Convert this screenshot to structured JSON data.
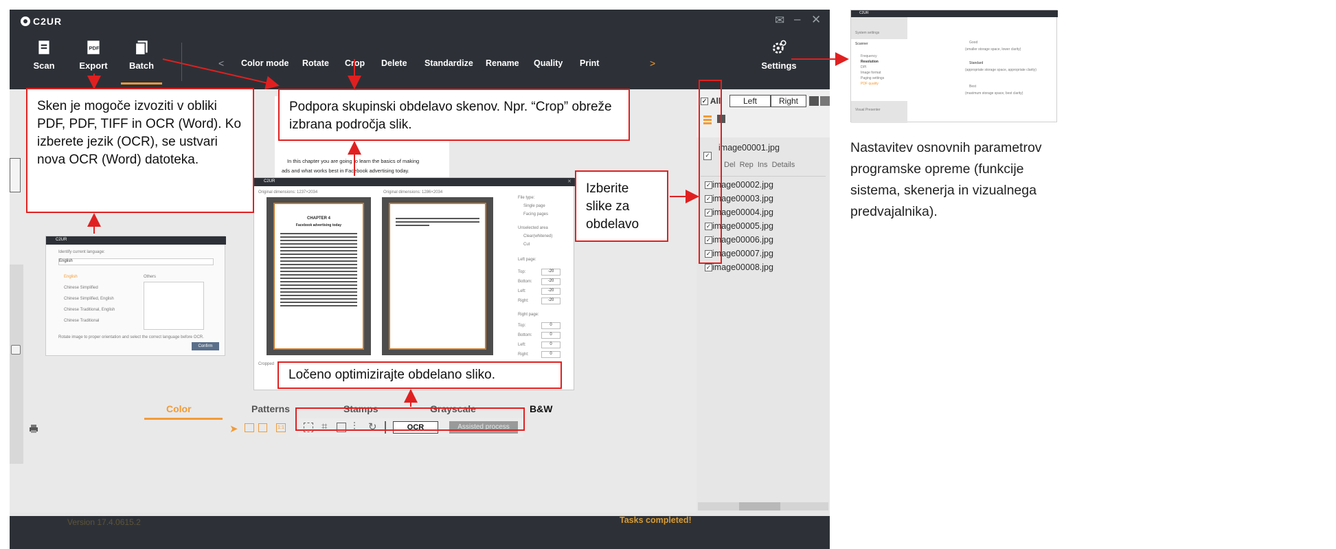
{
  "app": {
    "brand": "C2UR",
    "toolbar": {
      "scan_label": "Scan",
      "export_label": "Export",
      "batch_label": "Batch",
      "settings_label": "Settings",
      "menu": [
        "Color mode",
        "Rotate",
        "Crop",
        "Delete",
        "Standardize",
        "Rename",
        "Quality",
        "Print"
      ]
    },
    "right_panel": {
      "all_label": "All",
      "left_label": "Left",
      "right_label": "Right",
      "first_file": "image00001.jpg",
      "file_actions": [
        "Del",
        "Rep",
        "Ins",
        "Details"
      ],
      "files": [
        "image00002.jpg",
        "image00003.jpg",
        "image00004.jpg",
        "image00005.jpg",
        "image00006.jpg",
        "image00007.jpg",
        "image00008.jpg"
      ]
    },
    "modes": [
      "Color",
      "Patterns",
      "Stamps",
      "Grayscale",
      "B&W"
    ],
    "ocr_label": "OCR",
    "assisted_label": "Assisted process",
    "version": "Version 17.4.0615.2",
    "tasks": "Tasks completed!"
  },
  "colors": {
    "dark": "#2d3137",
    "accent": "#f29b37",
    "callout": "#e02020"
  },
  "callouts": {
    "export": "Sken je mogoče izvoziti v obliki PDF, PDF, TIFF in OCR (Word). Ko izberete jezik (OCR), se ustvari nova OCR (Word) datoteka.",
    "batch": "Podpora skupinski obdelavo skenov. Npr. “Crop” obreže izbrana področja slik.",
    "select": "Izberite slike za obdelavo",
    "optimize": "Ločeno optimizirajte obdelano sliko."
  },
  "side_caption": "Nastavitev osnovnih parametrov programske opreme (funkcije sistema, skenerja in vizualnega predvajalnika).",
  "preview_doc": {
    "line1": "In this chapter you are going to learn the basics of making",
    "line2": "ads and what works best in Facebook advertising today."
  },
  "ocr_dialog": {
    "title": "C2UR",
    "prompt": "Identify current language:",
    "current": "English",
    "langs": [
      "English",
      "Chinese Simplified",
      "Chinese Simplified, English",
      "Chinese Traditional, English",
      "Chinese Traditional"
    ],
    "others": "Others",
    "hint": "Rotate image to proper orientation and select the correct language before OCR.",
    "confirm": "Confirm"
  },
  "crop_dialog": {
    "title": "C2UR",
    "orig1": "Original dimensions: 1237×2034",
    "orig2": "Original dimensions: 1286×2034",
    "chapter": "CHAPTER 4",
    "subtitle": "Facebook advertising today",
    "file_type": "File type:",
    "single": "Single page",
    "facing": "Facing pages",
    "unselected": "Unselected area",
    "clear": "Clear(whitened)",
    "cut": "Cut",
    "left_page": "Left page:",
    "right_page": "Right page:",
    "fields": [
      "Top:",
      "Bottom:",
      "Left:",
      "Right:"
    ],
    "left_vals": [
      "-20",
      "-20",
      "-20",
      "-20"
    ],
    "right_vals": [
      "0",
      "0",
      "0",
      "0"
    ],
    "cropped": "Cropped"
  },
  "settings_thumb": {
    "title": "C2UR",
    "system": "System settings",
    "scanner": "Scanner",
    "items": [
      "Frequency",
      "Resolution",
      "DPI",
      "Image format",
      "Paging settings",
      "PDF quality"
    ],
    "visual": "Visual Presenter",
    "good": "Good",
    "good_desc": "(smaller storage space, lower clarity)",
    "standard": "Standard",
    "standard_desc": "(appropriate storage space, appropriate clarity)",
    "best": "Best",
    "best_desc": "(maximum storage space, best clarity)"
  }
}
